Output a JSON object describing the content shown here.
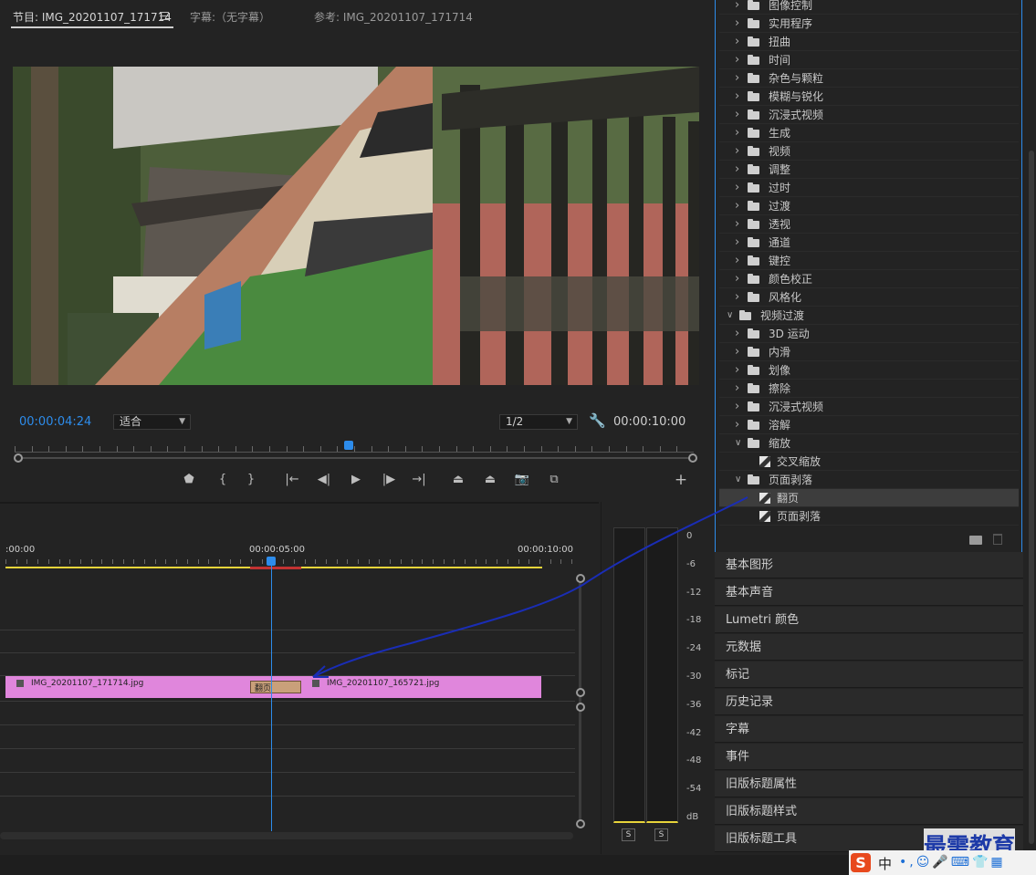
{
  "program_monitor": {
    "tabs": [
      {
        "label": "节目: IMG_20201107_171714"
      },
      {
        "label": "字幕:（无字幕）"
      },
      {
        "label": "参考: IMG_20201107_171714"
      }
    ],
    "menu_icon": "hamburger-icon",
    "timecode_current": "00:00:04:24",
    "zoom_select": "适合",
    "resolution_select": "1/2",
    "timecode_duration": "00:00:10:00",
    "controls": [
      "marker-icon",
      "mark-in-icon",
      "mark-out-icon",
      "go-to-in-icon",
      "step-back-icon",
      "play-icon",
      "step-forward-icon",
      "go-to-out-icon",
      "lift-icon",
      "extract-icon",
      "export-frame-icon",
      "compare-icon",
      "add-button-icon"
    ]
  },
  "effects_panel": {
    "items": [
      {
        "label": "图像控制",
        "type": "folder",
        "expanded": false,
        "level": 1
      },
      {
        "label": "实用程序",
        "type": "folder",
        "expanded": false,
        "level": 1
      },
      {
        "label": "扭曲",
        "type": "folder",
        "expanded": false,
        "level": 1
      },
      {
        "label": "时间",
        "type": "folder",
        "expanded": false,
        "level": 1
      },
      {
        "label": "杂色与颗粒",
        "type": "folder",
        "expanded": false,
        "level": 1
      },
      {
        "label": "模糊与锐化",
        "type": "folder",
        "expanded": false,
        "level": 1
      },
      {
        "label": "沉浸式视频",
        "type": "folder",
        "expanded": false,
        "level": 1
      },
      {
        "label": "生成",
        "type": "folder",
        "expanded": false,
        "level": 1
      },
      {
        "label": "视频",
        "type": "folder",
        "expanded": false,
        "level": 1
      },
      {
        "label": "调整",
        "type": "folder",
        "expanded": false,
        "level": 1
      },
      {
        "label": "过时",
        "type": "folder",
        "expanded": false,
        "level": 1
      },
      {
        "label": "过渡",
        "type": "folder",
        "expanded": false,
        "level": 1
      },
      {
        "label": "透视",
        "type": "folder",
        "expanded": false,
        "level": 1
      },
      {
        "label": "通道",
        "type": "folder",
        "expanded": false,
        "level": 1
      },
      {
        "label": "键控",
        "type": "folder",
        "expanded": false,
        "level": 1
      },
      {
        "label": "颜色校正",
        "type": "folder",
        "expanded": false,
        "level": 1
      },
      {
        "label": "风格化",
        "type": "folder",
        "expanded": false,
        "level": 1
      },
      {
        "label": "视频过渡",
        "type": "folder",
        "expanded": true,
        "level": 0
      },
      {
        "label": "3D 运动",
        "type": "folder",
        "expanded": false,
        "level": 1
      },
      {
        "label": "内滑",
        "type": "folder",
        "expanded": false,
        "level": 1
      },
      {
        "label": "划像",
        "type": "folder",
        "expanded": false,
        "level": 1
      },
      {
        "label": "擦除",
        "type": "folder",
        "expanded": false,
        "level": 1
      },
      {
        "label": "沉浸式视频",
        "type": "folder",
        "expanded": false,
        "level": 1
      },
      {
        "label": "溶解",
        "type": "folder",
        "expanded": false,
        "level": 1
      },
      {
        "label": "缩放",
        "type": "folder",
        "expanded": true,
        "level": 1
      },
      {
        "label": "交叉缩放",
        "type": "effect",
        "level": 2
      },
      {
        "label": "页面剥落",
        "type": "folder",
        "expanded": true,
        "level": 1
      },
      {
        "label": "翻页",
        "type": "effect",
        "level": 2,
        "selected": true
      },
      {
        "label": "页面剥落",
        "type": "effect",
        "level": 2
      }
    ],
    "footer_icons": [
      "new-bin-icon",
      "trash-icon"
    ]
  },
  "side_panels": [
    "基本图形",
    "基本声音",
    "Lumetri 颜色",
    "元数据",
    "标记",
    "历史记录",
    "字幕",
    "事件",
    "旧版标题属性",
    "旧版标题样式",
    "旧版标题工具"
  ],
  "timeline": {
    "ruler_labels": [
      ":00:00",
      "00:00:05:00",
      "00:00:10:00"
    ],
    "clip_a": "IMG_20201107_171714.jpg",
    "clip_b": "IMG_20201107_165721.jpg",
    "transition_label": "翻页"
  },
  "audio_meter": {
    "scale": [
      "0",
      "-6",
      "-12",
      "-18",
      "-24",
      "-30",
      "-36",
      "-42",
      "-48",
      "-54",
      "dB"
    ],
    "solo_buttons": [
      "S",
      "S"
    ]
  },
  "watermark": "最需教育",
  "ime_bar": {
    "label": "中"
  },
  "colors": {
    "accent_blue": "#2d8ceb",
    "clip_pink": "#e086dc",
    "transition": "#c9a07a",
    "work_area_yellow": "#e8d43a",
    "annotation_arrow": "#1a2db5"
  }
}
